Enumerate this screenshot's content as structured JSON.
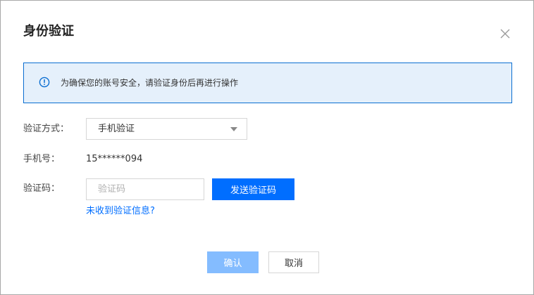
{
  "dialog": {
    "title": "身份验证",
    "close_icon": "close-icon"
  },
  "notice": {
    "icon": "info-circle-icon",
    "text": "为确保您的账号安全，请验证身份后再进行操作",
    "border_color": "#0a6ed1",
    "background": "#e5f0fb"
  },
  "form": {
    "method": {
      "label": "验证方式：",
      "selected": "手机验证",
      "caret_icon": "caret-down-icon"
    },
    "phone": {
      "label": "手机号：",
      "value": "15******094"
    },
    "code": {
      "label": "验证码：",
      "value": "",
      "placeholder": "验证码",
      "send_label": "发送验证码"
    },
    "help_link": "未收到验证信息?"
  },
  "footer": {
    "confirm_label": "确认",
    "cancel_label": "取消"
  },
  "colors": {
    "primary": "#006eff",
    "primary_disabled": "#84bcff"
  }
}
